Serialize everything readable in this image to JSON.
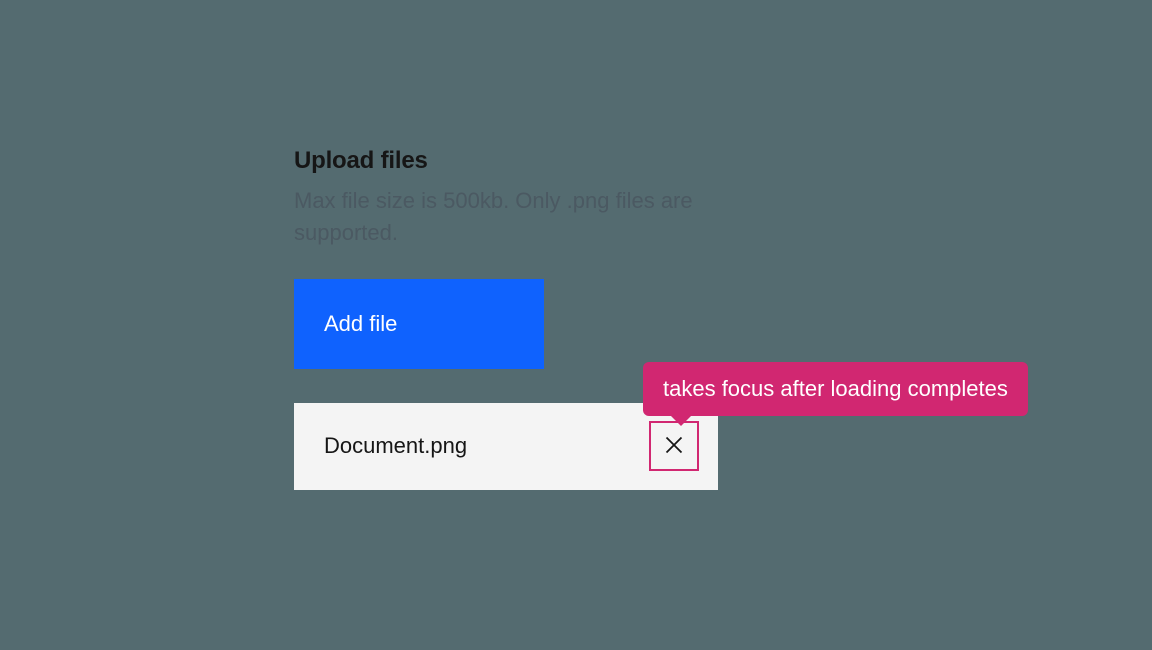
{
  "upload": {
    "title": "Upload files",
    "description": "Max file size is 500kb. Only .png files are supported.",
    "button_label": "Add file"
  },
  "file": {
    "name": "Document.png"
  },
  "tooltip": {
    "text": "takes focus after loading completes"
  }
}
